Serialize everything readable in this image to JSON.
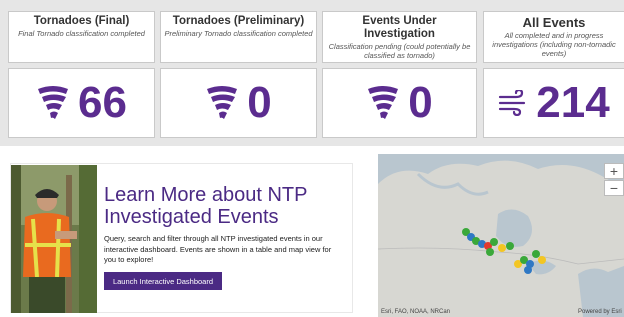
{
  "stats": [
    {
      "title": "Tornadoes (Final)",
      "subtitle": "Final Tornado classification completed",
      "value": "66",
      "icon": "tornado-icon"
    },
    {
      "title": "Tornadoes (Preliminary)",
      "subtitle": "Preliminary Tornado classification completed",
      "value": "0",
      "icon": "tornado-icon"
    },
    {
      "title": "Events Under Investigation",
      "subtitle": "Classification pending (could potentially be classified as tornado)",
      "value": "0",
      "icon": "tornado-icon"
    },
    {
      "title": "All Events",
      "subtitle": "All completed and in progress investigations (including non-tornadic events)",
      "value": "214",
      "icon": "wind-icon"
    }
  ],
  "promo": {
    "title": "Learn More about NTP Investigated Events",
    "text": "Query, search and filter through all NTP investigated events in our interactive dashboard. Events are shown in a table and map view for you to explore!",
    "button": "Launch Interactive Dashboard"
  },
  "map": {
    "zoom_in": "+",
    "zoom_out": "−",
    "attribution_left": "Esri, FAO, NOAA, NRCan",
    "attribution_right": "Powered by Esri"
  },
  "colors": {
    "accent": "#5b2c8f",
    "button": "#4b2a84"
  }
}
